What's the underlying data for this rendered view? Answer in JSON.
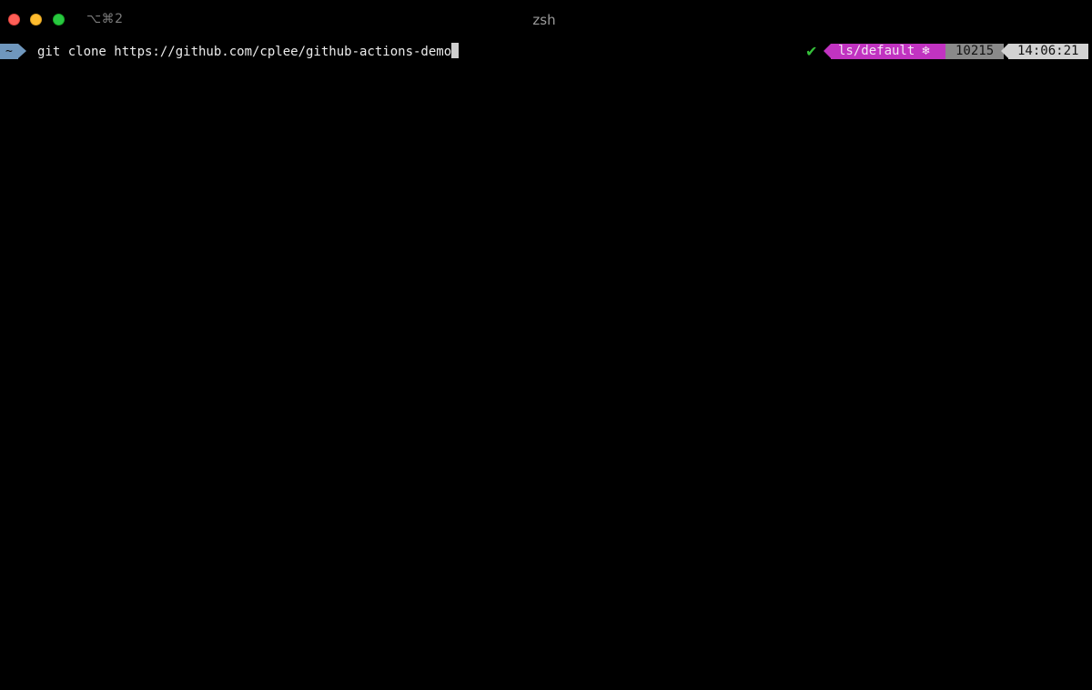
{
  "window": {
    "title": "zsh",
    "shortcut": "⌥⌘2",
    "controls": {
      "close": "close-button",
      "minimize": "minimize-button",
      "zoom": "zoom-button"
    }
  },
  "prompt": {
    "directory": "~",
    "command": "git clone https://github.com/cplee/github-actions-demo",
    "status_symbol": "✔",
    "context": "ls/default",
    "context_icon": "❄",
    "history_number": "10215",
    "time": "14:06:21"
  },
  "colors": {
    "background": "#000000",
    "directory_segment": "#6f97bd",
    "context_segment": "#c133c1",
    "history_segment": "#8a8a8a",
    "time_segment": "#d2d2d2",
    "status_ok": "#35c03a"
  }
}
